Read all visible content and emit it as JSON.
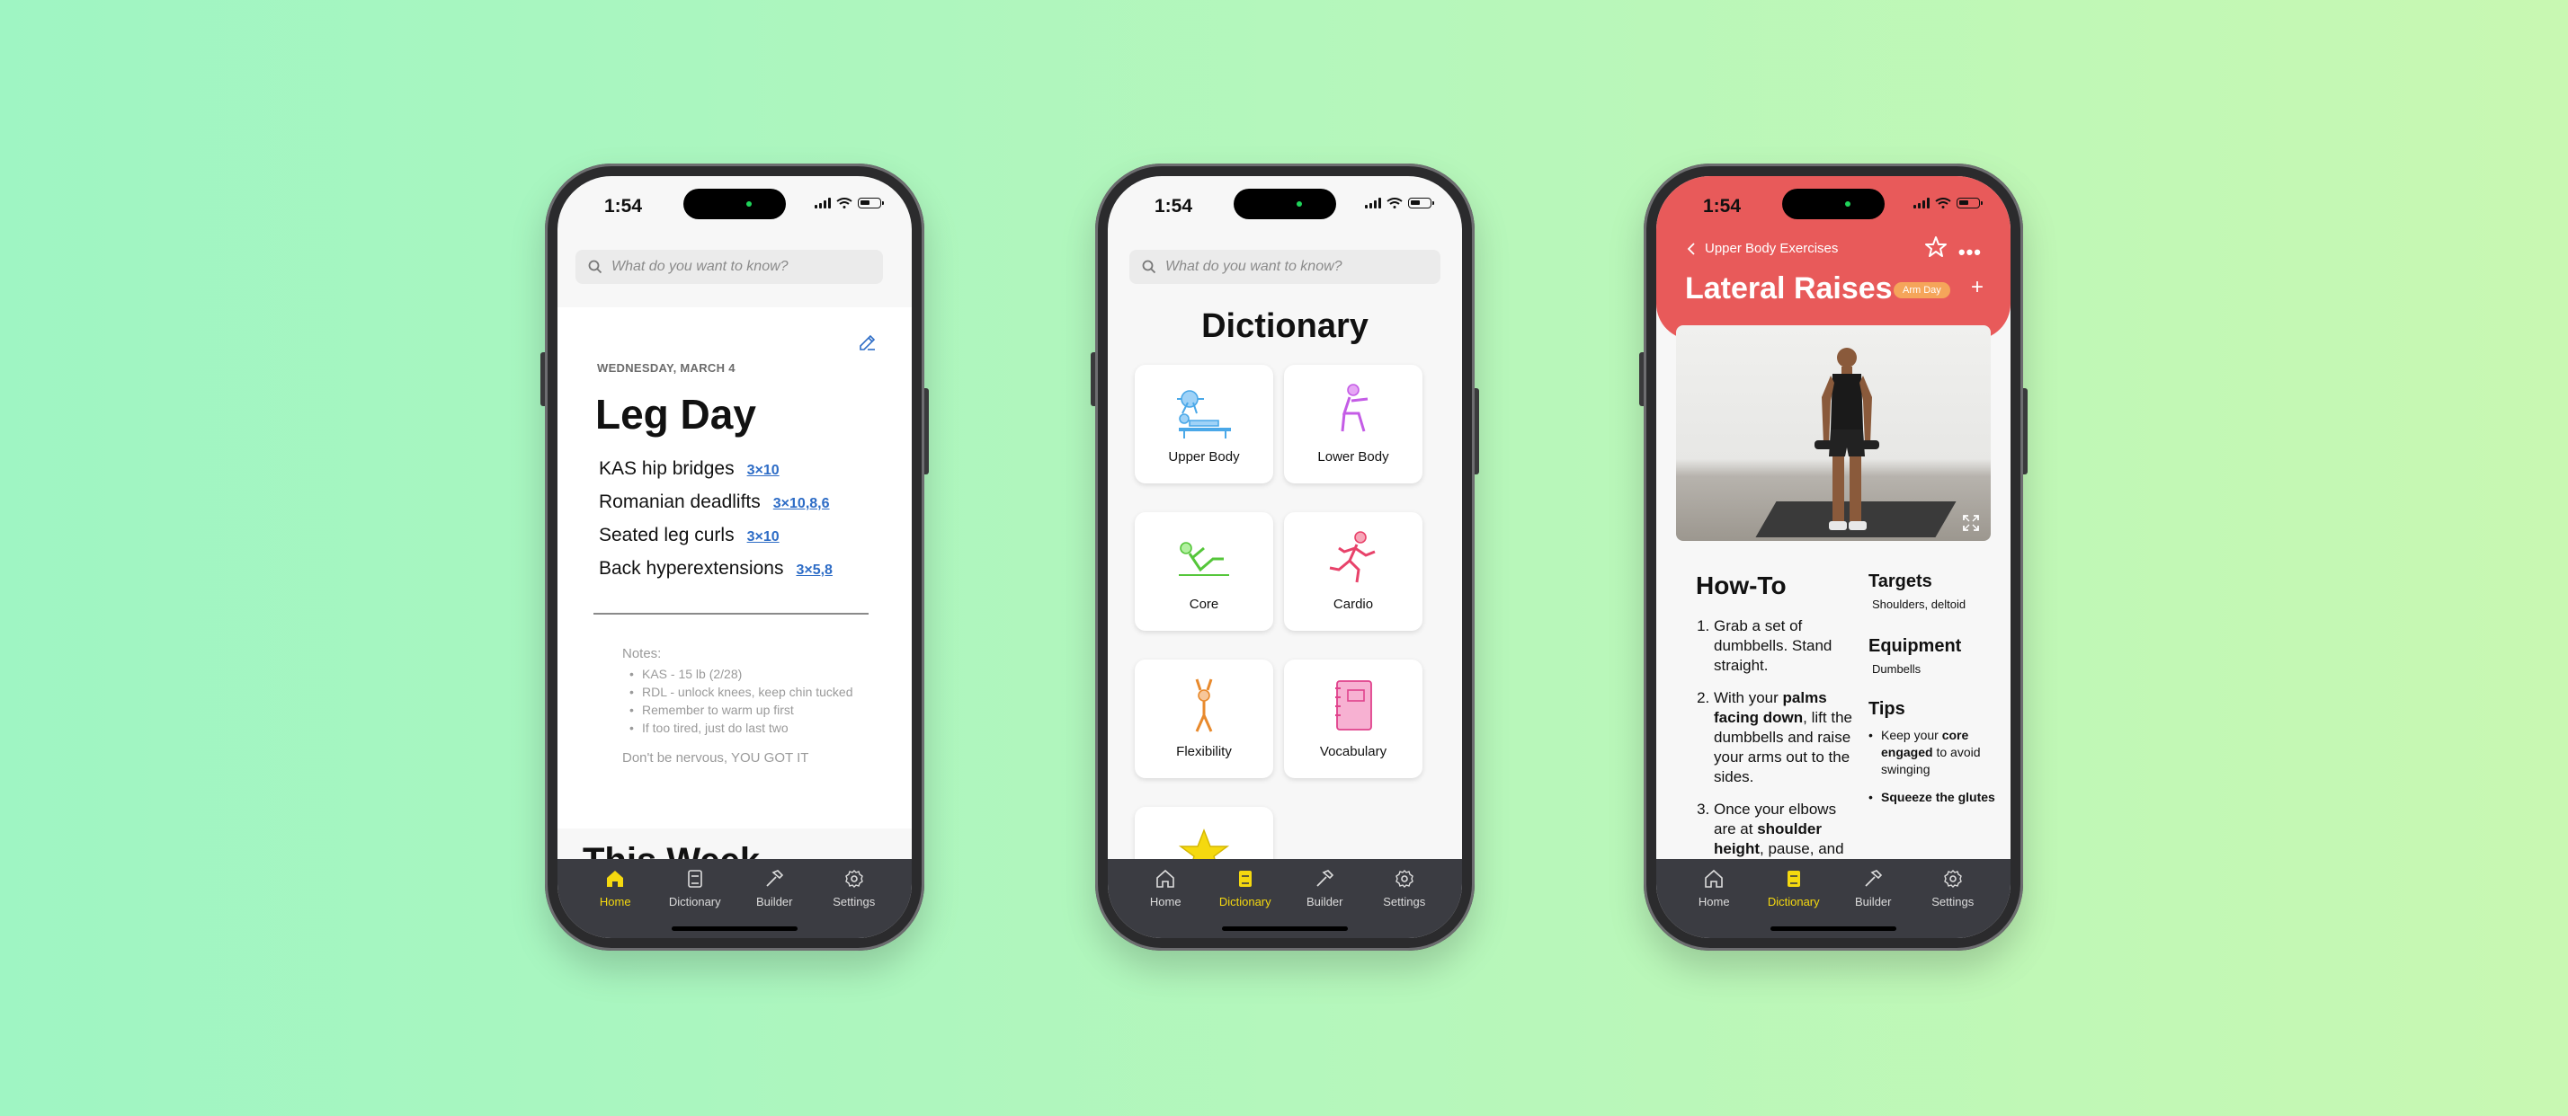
{
  "status": {
    "time": "1:54"
  },
  "search": {
    "placeholder": "What do you want to know?"
  },
  "tabs": [
    {
      "label": "Home"
    },
    {
      "label": "Dictionary"
    },
    {
      "label": "Builder"
    },
    {
      "label": "Settings"
    }
  ],
  "colors": {
    "accent_yellow": "#f5d90f",
    "link_blue": "#2d6cc6",
    "header_red": "#e85a5a",
    "tabbar": "#3b3c42",
    "badge_orange": "#f5a55a"
  },
  "home": {
    "date": "WEDNESDAY, MARCH 4",
    "title": "Leg Day",
    "exercises": [
      {
        "name": "KAS hip bridges",
        "sets": "3×10"
      },
      {
        "name": "Romanian deadlifts",
        "sets": "3×10,8,6"
      },
      {
        "name": "Seated leg curls",
        "sets": "3×10"
      },
      {
        "name": "Back hyperextensions",
        "sets": "3×5,8"
      }
    ],
    "notes_label": "Notes:",
    "notes": [
      "KAS - 15 lb (2/28)",
      "RDL - unlock knees, keep chin tucked",
      "Remember to warm up first",
      "If too tired, just do last two"
    ],
    "closing": "Don't be nervous, YOU GOT IT",
    "section_next": "This Week"
  },
  "dictionary": {
    "title": "Dictionary",
    "categories": [
      {
        "label": "Upper Body",
        "icon": "bench-press-icon"
      },
      {
        "label": "Lower Body",
        "icon": "squat-icon"
      },
      {
        "label": "Core",
        "icon": "situp-icon"
      },
      {
        "label": "Cardio",
        "icon": "running-icon"
      },
      {
        "label": "Flexibility",
        "icon": "stretch-icon"
      },
      {
        "label": "Vocabulary",
        "icon": "book-icon"
      }
    ]
  },
  "exercise": {
    "back_label": "Upper Body Exercises",
    "title": "Lateral Raises",
    "badge": "Arm Day",
    "howto_title": "How-To",
    "steps": [
      {
        "pre": "Grab a set of dumbbells. Stand straight.",
        "bold": "",
        "post": ""
      },
      {
        "pre": "With your ",
        "bold": "palms facing down",
        "post": ", lift the dumbbells and raise your arms out to the sides."
      },
      {
        "pre": "Once your elbows are at ",
        "bold": "shoulder height",
        "post": ", pause, and"
      }
    ],
    "targets_title": "Targets",
    "targets": "Shoulders, deltoid",
    "equipment_title": "Equipment",
    "equipment": "Dumbells",
    "tips_title": "Tips",
    "tips": [
      {
        "pre": "Keep your ",
        "bold": "core engaged",
        "post": " to avoid swinging"
      },
      {
        "pre": "",
        "bold": "Squeeze the glutes",
        "post": ""
      }
    ]
  }
}
